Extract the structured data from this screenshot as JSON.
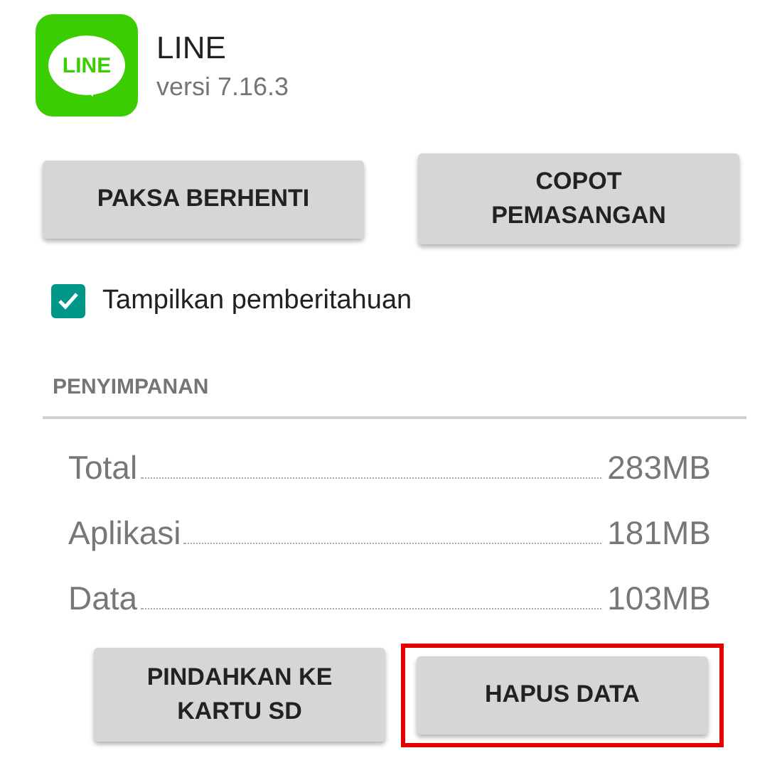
{
  "app": {
    "logo_text": "LINE",
    "name": "LINE",
    "version": "versi 7.16.3"
  },
  "actions": [
    {
      "label": "PAKSA BERHENTI"
    },
    {
      "label": "COPOT PEMASANGAN"
    }
  ],
  "notifications": {
    "label": "Tampilkan pemberitahuan",
    "checked": true
  },
  "storage": {
    "title": "PENYIMPANAN",
    "rows": [
      {
        "label": "Total",
        "value": "283MB"
      },
      {
        "label": "Aplikasi",
        "value": "181MB"
      },
      {
        "label": "Data",
        "value": "103MB"
      }
    ],
    "buttons": [
      {
        "label": "PINDAHKAN KE KARTU SD",
        "highlighted": false
      },
      {
        "label": "HAPUS DATA",
        "highlighted": true
      }
    ]
  }
}
